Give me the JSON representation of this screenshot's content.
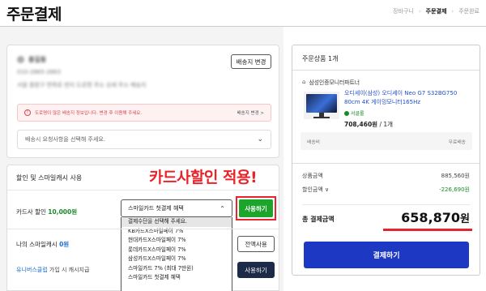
{
  "page": {
    "title": "주문결제",
    "breadcrumb": [
      "장바구니",
      "주문결제",
      "주문완료"
    ]
  },
  "address": {
    "name": "홍길동",
    "phone": "010-2865-2863",
    "line": "서울 중랑구 면목로 번지 도로명 주소 상세 주소 배송지",
    "change_button": "배송지 변경",
    "notice_text": "도로명이 많은 배송지 정보입니다. 변경 후 이용해 주세요.",
    "notice_link": "배송지 변경 >",
    "memo_placeholder": "배송시 요청사항을 선택해 주세요."
  },
  "discount": {
    "title": "할인 및 스마일캐시 사용",
    "promo": "카드사할인 적용!",
    "card_label": "카드사 할인",
    "card_amount": "10,000원",
    "card_select_value": "스마일카드 첫결제 혜택",
    "apply_button": "사용하기",
    "options": [
      "결제수단을 선택해 주세요.",
      "KB카드X스마일페이 7%",
      "현대카드X스마일페이 7%",
      "롯데카드X스마일페이 7%",
      "삼성카드X스마일페이 7%",
      "스마일카드 7% (최대 7만원)",
      "스마일카드 첫결제 혜택"
    ],
    "cash_label": "나의 스마일캐시",
    "cash_amount": "0원",
    "use_all_button": "전액사용",
    "uni_link": "유니버스클럽",
    "uni_text": "가입 시 캐시지급",
    "use_button": "사용하기"
  },
  "summary": {
    "header": "주문상품 1개",
    "seller": "삼성인증모니터파트너",
    "product_name": "오디세이(삼성) 오디세이 Neo G7 S32BG750 80cm 4K 게이밍모니터165Hz",
    "badge": "서클롤",
    "price": "708,460원",
    "quantity": "/ 1개",
    "ship_left": "배송비",
    "ship_right": "무료배송",
    "product_total_label": "상품금액",
    "product_total": "885,560원",
    "discount_label": "할인금액 ∨",
    "discount_value": "-226,690원",
    "total_label": "총 결제금액",
    "total_value": "658,870",
    "total_unit": "원",
    "pay_button": "결제하기"
  },
  "colors": {
    "promo_red": "#e8242a",
    "apply_green": "#1ca52b",
    "pay_blue": "#1d39c4",
    "navy": "#1d2a48"
  }
}
